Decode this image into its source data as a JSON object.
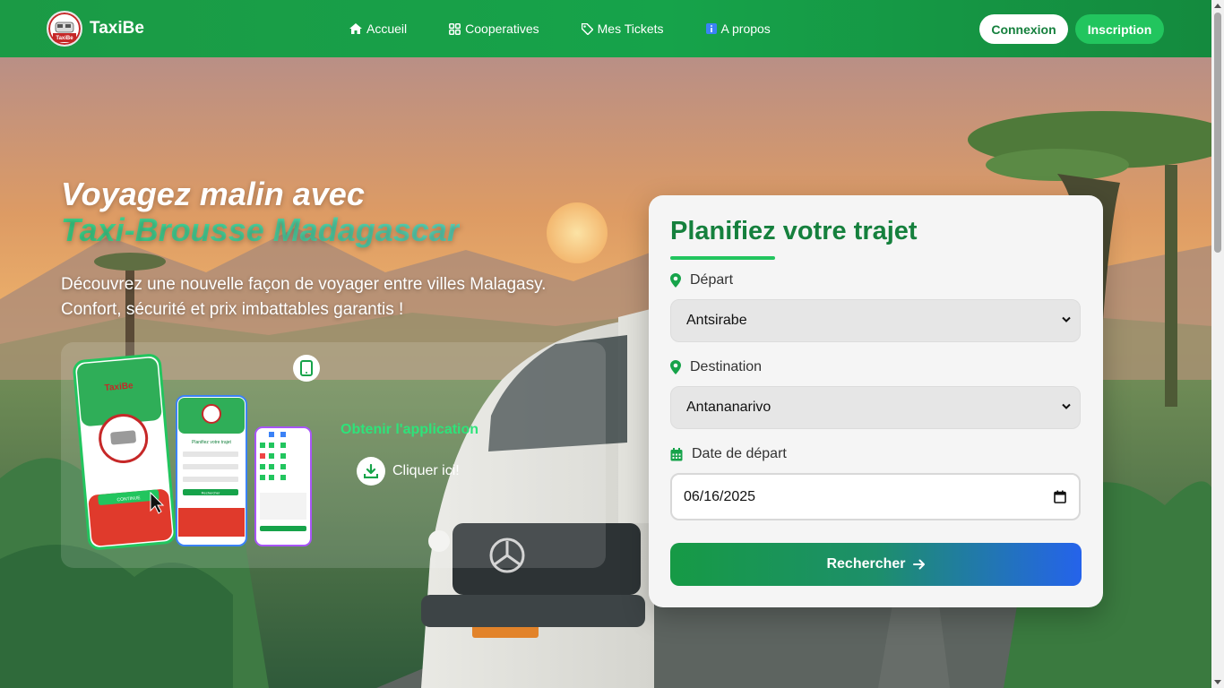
{
  "brand": {
    "name": "TaxiBe",
    "logo_text": "TaxiBe"
  },
  "nav": {
    "items": [
      {
        "label": "Accueil",
        "icon": "home-icon"
      },
      {
        "label": "Cooperatives",
        "icon": "grid-icon"
      },
      {
        "label": "Mes Tickets",
        "icon": "ticket-icon"
      },
      {
        "label": "A propos",
        "icon": "info-icon"
      }
    ],
    "login_label": "Connexion",
    "signup_label": "Inscription"
  },
  "hero": {
    "headline_line1": "Voyagez malin avec",
    "headline_line2": "Taxi-Brousse Madagascar",
    "subtitle": "Découvrez une nouvelle façon de voyager entre villes Malagasy. Confort, sécurité et prix imbattables garantis !"
  },
  "app_promo": {
    "get_app_label": "Obtenir l'application",
    "click_label": "Cliquer ici!",
    "phone_brand": "TaxiBe",
    "phone_button": "CONTINUE",
    "phone_form_title": "Planifiez votre trajet",
    "phone_form_button": "Rechercher"
  },
  "form": {
    "title": "Planifiez votre trajet",
    "departure": {
      "label": "Départ",
      "value": "Antsirabe"
    },
    "destination": {
      "label": "Destination",
      "value": "Antananarivo"
    },
    "date": {
      "label": "Date de départ",
      "value": "06/16/2025"
    },
    "submit_label": "Rechercher"
  },
  "colors": {
    "primary_green": "#16a34a",
    "dark_green": "#15803d",
    "accent_blue": "#2563eb",
    "bright_green": "#22c55e"
  }
}
